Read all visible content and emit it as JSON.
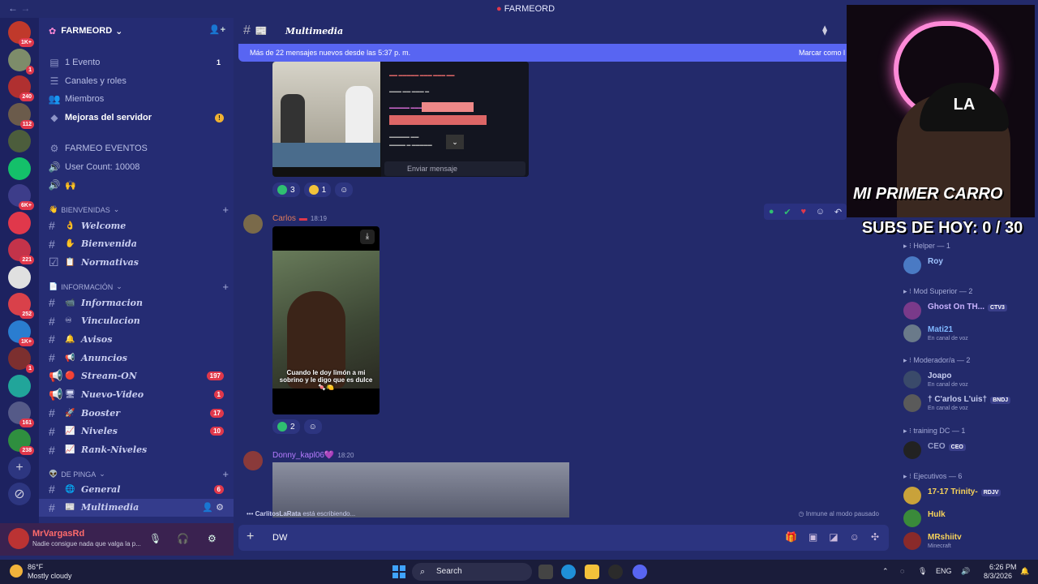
{
  "window": {
    "title": "FARMEORD",
    "nav_back": "←",
    "nav_fwd": "→"
  },
  "servers": [
    {
      "badge": "1K+",
      "color": "#c0392b"
    },
    {
      "badge": "1",
      "color": "#7d8c6a"
    },
    {
      "badge": "240",
      "color": "#b03030"
    },
    {
      "badge": "112",
      "color": "#6b5b4b"
    },
    {
      "badge": "",
      "color": "#4c5d3c"
    },
    {
      "badge": "",
      "color": "#14c06a"
    },
    {
      "badge": "6K+",
      "color": "#3d3d8a"
    },
    {
      "badge": "",
      "color": "#e0384b"
    },
    {
      "badge": "221",
      "color": "#c4334a"
    },
    {
      "badge": "",
      "color": "#e0e0e0"
    },
    {
      "badge": "252",
      "color": "#d9414a"
    },
    {
      "badge": "1K+",
      "color": "#2a7dd0"
    },
    {
      "badge": "1",
      "color": "#7c2f2f"
    },
    {
      "badge": "",
      "color": "#21a59a"
    },
    {
      "badge": "161",
      "color": "#555a88"
    },
    {
      "badge": "238",
      "color": "#2f8f3f"
    }
  ],
  "server": {
    "name": "FARMEORD"
  },
  "sidebar_top": [
    {
      "icon": "▤",
      "label": "1 Evento",
      "count": "1"
    },
    {
      "icon": "☰",
      "label": "Canales y roles",
      "count": ""
    },
    {
      "icon": "👥",
      "label": "Miembros",
      "count": ""
    },
    {
      "icon": "◆",
      "label": "Mejoras del servidor",
      "count": "!"
    }
  ],
  "sidebar_info": [
    {
      "icon": "⚙",
      "label": "FARMEO EVENTOS"
    },
    {
      "icon": "🔊",
      "label": "User Count: 10008"
    },
    {
      "icon": "🔊",
      "label": "🙌"
    }
  ],
  "categories": {
    "bienvenidas": "BIENVENIDAS",
    "informacion": "INFORMACIÓN",
    "de_pinga": "DE PINGA"
  },
  "channels_bienvenidas": [
    {
      "hash": "#",
      "emoji": "👌",
      "name": "Welcome",
      "count": ""
    },
    {
      "hash": "#",
      "emoji": "✋",
      "name": "Bienvenida",
      "count": ""
    },
    {
      "hash": "☑",
      "emoji": "📋",
      "name": "Normativas",
      "count": ""
    }
  ],
  "channels_info": [
    {
      "hash": "#",
      "emoji": "📹",
      "name": "Informacion",
      "count": ""
    },
    {
      "hash": "#",
      "emoji": "♾",
      "name": "Vinculacion",
      "count": ""
    },
    {
      "hash": "#",
      "emoji": "🔔",
      "name": "Avisos",
      "count": ""
    },
    {
      "hash": "#",
      "emoji": "📢",
      "name": "Anuncios",
      "count": ""
    },
    {
      "hash": "📢",
      "emoji": "🔴",
      "name": "Stream-ON",
      "count": "197"
    },
    {
      "hash": "📢",
      "emoji": "🖥",
      "name": "Nuevo-Video",
      "count": "1"
    },
    {
      "hash": "#",
      "emoji": "🚀",
      "name": "Booster",
      "count": "17"
    },
    {
      "hash": "#",
      "emoji": "📈",
      "name": "Niveles",
      "count": "10"
    },
    {
      "hash": "#",
      "emoji": "📈",
      "name": "Rank-Niveles",
      "count": ""
    }
  ],
  "channels_pinga": [
    {
      "hash": "#",
      "emoji": "🌐",
      "name": "General",
      "count": "6"
    },
    {
      "hash": "#",
      "emoji": "📰",
      "name": "Multimedia",
      "count": ""
    }
  ],
  "user": {
    "name": "MrVargasRd",
    "status": "Nadie consigue nada que valga la p..."
  },
  "chat": {
    "channel": "Multimedia",
    "banner": "Más de 22 mensajes nuevos desde las 5:37 p. m.",
    "banner_action": "Marcar como l",
    "mini_input": "Enviar mensaje",
    "react1": [
      {
        "count": "3"
      },
      {
        "count": "1"
      }
    ],
    "msg_carlos": {
      "author": "Carlos",
      "time": "18:19",
      "caption": "Cuando le doy limón a mi sobrino y le digo que es dulce 🍬🍋"
    },
    "react2": [
      {
        "count": "2"
      }
    ],
    "msg_donny": {
      "author": "Donny_kapl06💜",
      "time": "18:20"
    },
    "typing_user": "CarlitosLaRata",
    "typing_text": "está escribiendo...",
    "slowmode": "Inmune al modo pausado",
    "composer_text": "DW"
  },
  "stream": {
    "hat": "LA",
    "overlay": "MI PRIMER CARRO",
    "subs": "SUBS DE HOY: 0 / 30"
  },
  "members": {
    "cat_helper": "Helper — 1",
    "cat_mod_superior": "Mod Superior — 2",
    "cat_moderador": "Moderador/a — 2",
    "cat_training": "training DC — 1",
    "cat_ejecutivos": "Ejecutivos — 6",
    "list": [
      {
        "name": "Roy",
        "status": "",
        "tag": "",
        "color": "#9fc4ff"
      },
      {
        "name": "Ghost On TH...",
        "status": "",
        "tag": "CTV3",
        "color": "#c9b3ff"
      },
      {
        "name": "Mati21",
        "status": "En canal de voz",
        "tag": "",
        "color": "#7fb8ff"
      },
      {
        "name": "Joapo",
        "status": "En canal de voz",
        "tag": "",
        "color": "#c7cdf0"
      },
      {
        "name": "† C'arlos L'uis†",
        "status": "En canal de voz",
        "tag": "BNDJ",
        "color": "#c7cdf0"
      },
      {
        "name": "CEO",
        "status": "",
        "tag": "CEO",
        "color": "#9aa0cc"
      },
      {
        "name": "17-17 Trinity-",
        "status": "",
        "tag": "RDJV",
        "color": "#f7d35a"
      },
      {
        "name": "Hulk",
        "status": "",
        "tag": "",
        "color": "#f7d35a"
      },
      {
        "name": "MRshiitv",
        "status": "Minecraft",
        "tag": "",
        "color": "#f7d35a"
      }
    ]
  },
  "taskbar": {
    "temp": "86°F",
    "weather": "Mostly cloudy",
    "search": "Search",
    "lang": "ENG",
    "time": "6:26 PM",
    "date": "8/3/2026"
  }
}
